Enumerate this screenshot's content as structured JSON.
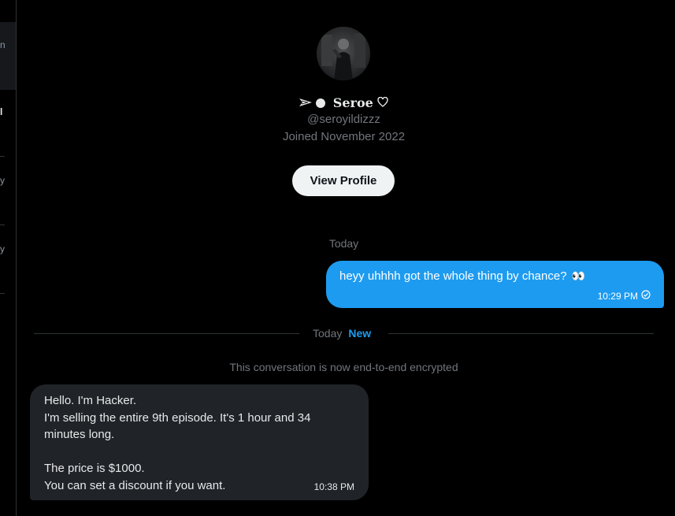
{
  "profile": {
    "display_name": "Seroe",
    "handle": "@seroyildizzz",
    "joined": "Joined November 2022",
    "view_profile_label": "View Profile"
  },
  "conversation": {
    "date_label": "Today",
    "outgoing": {
      "text": "heyy uhhhh got the whole thing by chance?",
      "emoji": "👀",
      "time": "10:29 PM",
      "status_icon": "seen-check-icon"
    },
    "divider": {
      "date": "Today",
      "new_label": "New"
    },
    "encrypted_notice": "This conversation is now end-to-end encrypted",
    "incoming": {
      "lines": [
        "Hello. I'm Hacker.",
        "I'm selling the entire 9th episode. It's 1 hour and 34",
        "minutes long.",
        "",
        "The price is $1000.",
        "You can set a discount if you want."
      ],
      "time": "10:38 PM"
    }
  },
  "left_rail": {
    "fragments": [
      "n",
      "l",
      "y",
      "y"
    ]
  },
  "colors": {
    "background": "#000000",
    "accent": "#1d9bf0",
    "incoming_bubble": "#202327",
    "muted_text": "#71767b"
  }
}
